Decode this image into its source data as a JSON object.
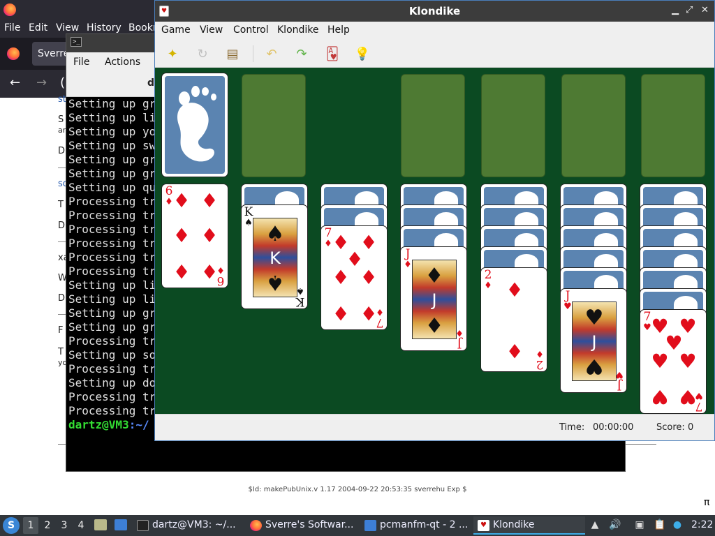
{
  "firefox": {
    "menu": [
      "File",
      "Edit",
      "View",
      "History",
      "Bookm"
    ],
    "tab_title": "Sverre",
    "page_fragments": [
      "st",
      "S",
      "ar",
      "D",
      "so",
      "T",
      "D",
      "xa",
      "W",
      "D",
      "F",
      "T",
      "yo"
    ],
    "footer": "$Id: makePubUnix.v 1.17 2004-09-22 20:53:35 sverrehu Exp $",
    "pi": "π"
  },
  "terminal": {
    "menu": [
      "File",
      "Actions"
    ],
    "tab_label": "d",
    "lines": [
      "Setting up gr",
      "Setting up li",
      "Setting up yo",
      "Setting up sw",
      "Setting up gr",
      "Setting up gr",
      "Setting up qu",
      "Processing tr",
      "Processing tr",
      "Processing tr",
      "Processing tr",
      "Processing tr",
      "Processing tr",
      "Setting up li",
      "Setting up li",
      "Setting up gr",
      "Setting up gr",
      "Processing tr",
      "Setting up so",
      "Processing tr",
      "Setting up do",
      "Processing tr",
      "Processing tr"
    ],
    "prompt_user": "dartz@VM3",
    "prompt_path": ":~/"
  },
  "klondike": {
    "title": "Klondike",
    "menu": [
      "Game",
      "View",
      "Control",
      "Klondike",
      "Help"
    ],
    "toolbar": {
      "new": "new-game-icon",
      "restart": "restart-icon",
      "select": "select-game-icon",
      "undo": "undo-icon",
      "redo": "redo-icon",
      "deal": "deal-icon",
      "hint": "hint-icon"
    },
    "status": {
      "time_label": "Time:",
      "time": "00:00:00",
      "score_label": "Score:",
      "score": "0"
    },
    "tableau": [
      {
        "face_down": 0,
        "top": {
          "rank": "6",
          "suit": "♦"
        }
      },
      {
        "face_down": 1,
        "top": {
          "rank": "K",
          "suit": "♠"
        }
      },
      {
        "face_down": 2,
        "top": {
          "rank": "7",
          "suit": "♦"
        }
      },
      {
        "face_down": 3,
        "top": {
          "rank": "J",
          "suit": "♦"
        }
      },
      {
        "face_down": 4,
        "top": {
          "rank": "2",
          "suit": "♦"
        }
      },
      {
        "face_down": 5,
        "top": {
          "rank": "J",
          "suit": "♥"
        }
      },
      {
        "face_down": 6,
        "top": {
          "rank": "7",
          "suit": "♥"
        }
      }
    ],
    "colors": {
      "felt": "#0b4a22",
      "slot": "#4e7a33",
      "card_back": "#5b84b1",
      "red": "#e10d1b"
    }
  },
  "taskbar": {
    "start_letter": "S",
    "desktops": [
      "1",
      "2",
      "3",
      "4"
    ],
    "tasks": [
      "dartz@VM3: ~/...",
      "Sverre's Softwar...",
      "pcmanfm-qt - 2 ...",
      "Klondike"
    ],
    "clock": "2:22"
  }
}
